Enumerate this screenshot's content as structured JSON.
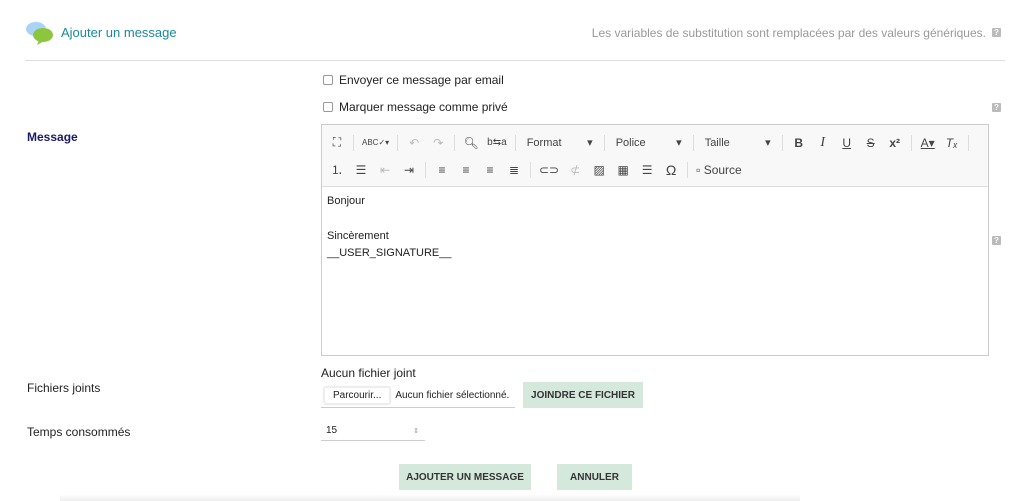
{
  "header": {
    "title": "Ajouter un message",
    "hint": "Les variables de substitution sont remplacées par des valeurs génériques.",
    "help": "?"
  },
  "options": {
    "email_label": "Envoyer ce message par email",
    "private_label": "Marquer message comme privé"
  },
  "message": {
    "label": "Message",
    "toolbar": {
      "format": "Format",
      "font": "Police",
      "size": "Taille",
      "source": "Source"
    },
    "content": [
      "Bonjour",
      "",
      "Sincèrement",
      "__USER_SIGNATURE__"
    ]
  },
  "attachments": {
    "label": "Fichiers joints",
    "none": "Aucun fichier joint",
    "browse": "Parcourir...",
    "no_file": "Aucun fichier sélectionné.",
    "attach_button": "JOINDRE CE FICHIER"
  },
  "time": {
    "label": "Temps consommés",
    "value": "15"
  },
  "actions": {
    "submit": "AJOUTER UN MESSAGE",
    "cancel": "ANNULER"
  },
  "colors": {
    "title": "#1a8a9a",
    "button": "#d5e8dc",
    "label": "#1a1a6a"
  }
}
